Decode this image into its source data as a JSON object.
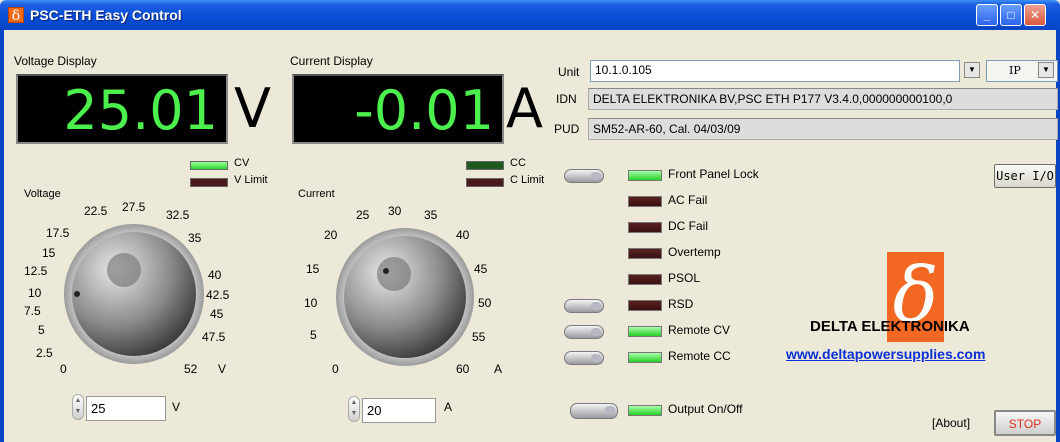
{
  "window": {
    "title": "PSC-ETH Easy Control",
    "title_icon": "δ",
    "buttons": {
      "minimize": "_",
      "maximize": "□",
      "close": "✕"
    }
  },
  "voltage_display": {
    "label": "Voltage Display",
    "value": "25.01",
    "unit": "V"
  },
  "current_display": {
    "label": "Current Display",
    "value": "-0.01",
    "unit": "A"
  },
  "voltage_leds": [
    {
      "label": "CV",
      "state": "on"
    },
    {
      "label": "V Limit",
      "state": "off"
    }
  ],
  "current_leds": [
    {
      "label": "CC",
      "state": "dim"
    },
    {
      "label": "C Limit",
      "state": "off"
    }
  ],
  "voltage_knob": {
    "label": "Voltage",
    "unit": "V",
    "ticks": [
      "0",
      "2.5",
      "5",
      "7.5",
      "10",
      "12.5",
      "15",
      "17.5",
      "22.5",
      "27.5",
      "32.5",
      "35",
      "40",
      "42.5",
      "45",
      "47.5",
      "52"
    ],
    "setpoint": "25",
    "setpoint_unit": "V"
  },
  "current_knob": {
    "label": "Current",
    "unit": "A",
    "ticks": [
      "0",
      "5",
      "10",
      "15",
      "20",
      "25",
      "30",
      "35",
      "40",
      "45",
      "50",
      "55",
      "60"
    ],
    "setpoint": "20",
    "setpoint_unit": "A"
  },
  "unit": {
    "label": "Unit",
    "value": "10.1.0.105",
    "protocol": "IP"
  },
  "idn": {
    "label": "IDN",
    "value": "DELTA ELEKTRONIKA BV,PSC ETH P177 V3.4.0,000000000100,0"
  },
  "pud": {
    "label": "PUD",
    "value": "SM52-AR-60, Cal.  04/03/09"
  },
  "status": [
    {
      "label": "Front Panel Lock",
      "state": "on",
      "toggle": true
    },
    {
      "label": "AC Fail",
      "state": "off",
      "toggle": false
    },
    {
      "label": "DC Fail",
      "state": "off",
      "toggle": false
    },
    {
      "label": "Overtemp",
      "state": "off",
      "toggle": false
    },
    {
      "label": "PSOL",
      "state": "off",
      "toggle": false
    },
    {
      "label": "RSD",
      "state": "off",
      "toggle": true
    },
    {
      "label": "Remote CV",
      "state": "on",
      "toggle": true
    },
    {
      "label": "Remote CC",
      "state": "on",
      "toggle": true
    }
  ],
  "output": {
    "label": "Output On/Off",
    "state": "on"
  },
  "user_io_button": "User I/O",
  "brand": {
    "name": "DELTA ELEKTRONIKA",
    "url": "www.deltapowersupplies.com",
    "logo_glyph": "δ"
  },
  "about_link": "[About]",
  "stop_button": "STOP",
  "colors": {
    "led_green": "#2fd52f",
    "led_off": "#4a1a1a",
    "display_digits": "#4cf04c",
    "logo_orange": "#f26722",
    "stop_text": "#e03020"
  }
}
